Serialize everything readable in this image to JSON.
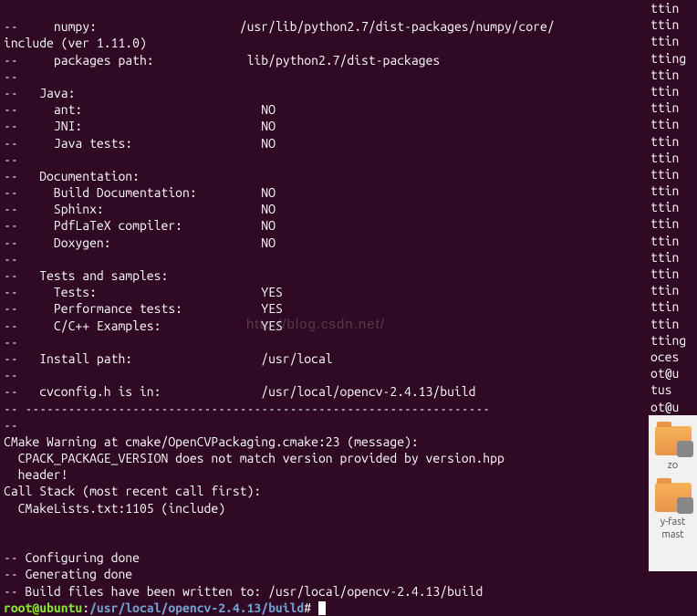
{
  "cfg": {
    "numpy_label": "numpy:",
    "numpy_path": "/usr/lib/python2.7/dist-packages/numpy/core/",
    "include_ver": "include (ver 1.11.0)",
    "packages_label": "packages path:",
    "packages_path": "lib/python2.7/dist-packages",
    "java_header": "Java:",
    "java_rows": [
      {
        "k": "ant:",
        "v": "NO"
      },
      {
        "k": "JNI:",
        "v": "NO"
      },
      {
        "k": "Java tests:",
        "v": "NO"
      }
    ],
    "doc_header": "Documentation:",
    "doc_rows": [
      {
        "k": "Build Documentation:",
        "v": "NO"
      },
      {
        "k": "Sphinx:",
        "v": "NO"
      },
      {
        "k": "PdfLaTeX compiler:",
        "v": "NO"
      },
      {
        "k": "Doxygen:",
        "v": "NO"
      }
    ],
    "tests_header": "Tests and samples:",
    "tests_rows": [
      {
        "k": "Tests:",
        "v": "YES"
      },
      {
        "k": "Performance tests:",
        "v": "YES"
      },
      {
        "k": "C/C++ Examples:",
        "v": "YES"
      }
    ],
    "install_label": "Install path:",
    "install_path": "/usr/local",
    "cvconfig_label": "cvconfig.h is in:",
    "cvconfig_path": "/usr/local/opencv-2.4.13/build",
    "rule": "-----------------------------------------------------------------"
  },
  "warn": {
    "l1": "CMake Warning at cmake/OpenCVPackaging.cmake:23 (message):",
    "l2": "  CPACK_PACKAGE_VERSION does not match version provided by version.hpp",
    "l3": "  header!",
    "l4": "Call Stack (most recent call first):",
    "l5": "  CMakeLists.txt:1105 (include)"
  },
  "done": {
    "configuring": "-- Configuring done",
    "generating": "-- Generating done",
    "written": "-- Build files have been written to: /usr/local/opencv-2.4.13/build"
  },
  "prompt": {
    "user_host": "root@ubuntu",
    "sep": ":",
    "path": "/usr/local/opencv-2.4.13/build",
    "hash": "#"
  },
  "right": {
    "lines": [
      "ttin",
      "ttin",
      "ttin",
      "tting",
      "ttin",
      "ttin",
      "ttin",
      "ttin",
      "ttin",
      "ttin",
      "ttin",
      "ttin",
      "ttin",
      "ttin",
      "ttin",
      "ttin",
      "ttin",
      "ttin",
      "ttin",
      "ttin",
      "tting",
      "oces",
      "ot@u",
      "tus",
      "ot@u"
    ],
    "label1": "zo",
    "label2": "y-fast",
    "label3": "mast"
  },
  "watermark": "http://blog.csdn.net/"
}
